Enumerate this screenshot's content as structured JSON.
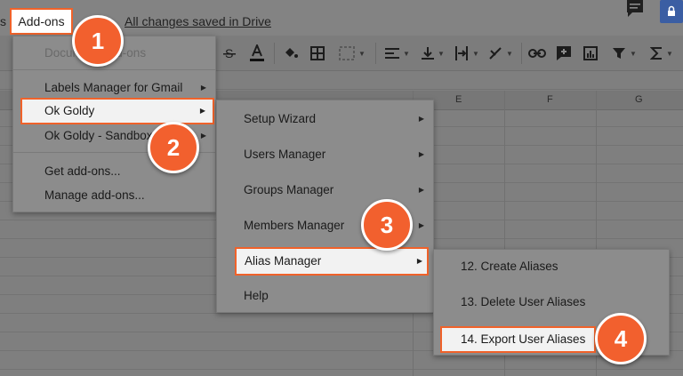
{
  "menubar": {
    "prev_tail": "s",
    "addons_label": "Add-ons",
    "saved_text": "All changes saved in Drive"
  },
  "icons": {
    "comment": "comment-icon",
    "lock": "lock-icon"
  },
  "columns": [
    "E",
    "F",
    "G"
  ],
  "addons_menu": {
    "items": [
      {
        "label": "Document add-ons"
      },
      {
        "label": "Labels Manager for Gmail"
      },
      {
        "label": "Ok Goldy"
      },
      {
        "label": "Ok Goldy - Sandbox"
      },
      {
        "label": "Get add-ons..."
      },
      {
        "label": "Manage add-ons..."
      }
    ]
  },
  "okgoldy_menu": {
    "items": [
      {
        "label": "Setup Wizard"
      },
      {
        "label": "Users Manager"
      },
      {
        "label": "Groups Manager"
      },
      {
        "label": "Members Manager"
      },
      {
        "label": "Alias Manager"
      },
      {
        "label": "Help"
      }
    ]
  },
  "alias_menu": {
    "items": [
      {
        "label": "12. Create Aliases"
      },
      {
        "label": "13. Delete User Aliases"
      },
      {
        "label": "14. Export User Aliases"
      }
    ]
  },
  "badges": [
    "1",
    "2",
    "3",
    "4"
  ],
  "colors": {
    "accent": "#f0622a",
    "badge": "#f2602e",
    "overlay": "#7f7f7f"
  }
}
